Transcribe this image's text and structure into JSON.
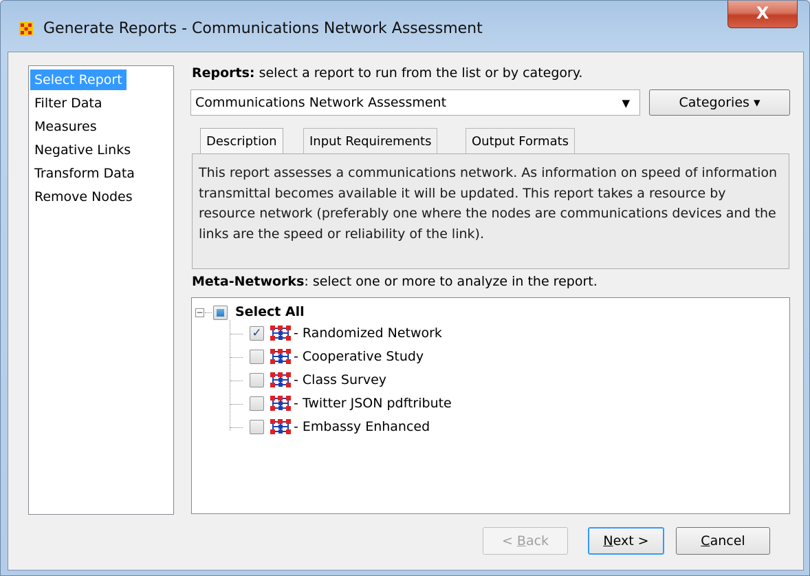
{
  "window": {
    "title": "Generate Reports - Communications Network Assessment",
    "close_label": "X"
  },
  "sidebar": {
    "items": [
      {
        "label": "Select Report",
        "selected": true
      },
      {
        "label": "Filter Data",
        "selected": false
      },
      {
        "label": "Measures",
        "selected": false
      },
      {
        "label": "Negative Links",
        "selected": false
      },
      {
        "label": "Transform Data",
        "selected": false
      },
      {
        "label": "Remove Nodes",
        "selected": false
      }
    ]
  },
  "reports": {
    "label_bold": "Reports:",
    "label_rest": " select a report to run from the list or by category.",
    "selected_report": "Communications Network Assessment",
    "categories_label": "Categories ▾"
  },
  "tabs": [
    {
      "label": "Description",
      "active": true
    },
    {
      "label": "Input Requirements",
      "active": false
    },
    {
      "label": "Output Formats",
      "active": false
    }
  ],
  "description": "This report assesses a communications network. As information on speed of information transmittal becomes available it will be updated. This report takes a resource by resource network (preferably one where the nodes are communications devices and the links are the speed or reliability of the link).",
  "meta_networks": {
    "label_bold": "Meta-Networks",
    "label_rest": ": select one or more to analyze in the report.",
    "select_all": "Select All",
    "items": [
      {
        "label": "- Randomized Network",
        "checked": true
      },
      {
        "label": "- Cooperative Study",
        "checked": false
      },
      {
        "label": "- Class Survey",
        "checked": false
      },
      {
        "label": "- Twitter JSON pdftribute",
        "checked": false
      },
      {
        "label": "- Embassy Enhanced",
        "checked": false
      }
    ]
  },
  "buttons": {
    "back_prefix": "< ",
    "back_u": "B",
    "back_rest": "ack",
    "next_u": "N",
    "next_rest": "ext >",
    "cancel_u": "C",
    "cancel_rest": "ancel"
  },
  "colors": {
    "selection": "#3399ff",
    "close_button": "#c9432a",
    "network_icon_nodes": "#e02020",
    "network_icon_links": "#1c3fb0"
  }
}
